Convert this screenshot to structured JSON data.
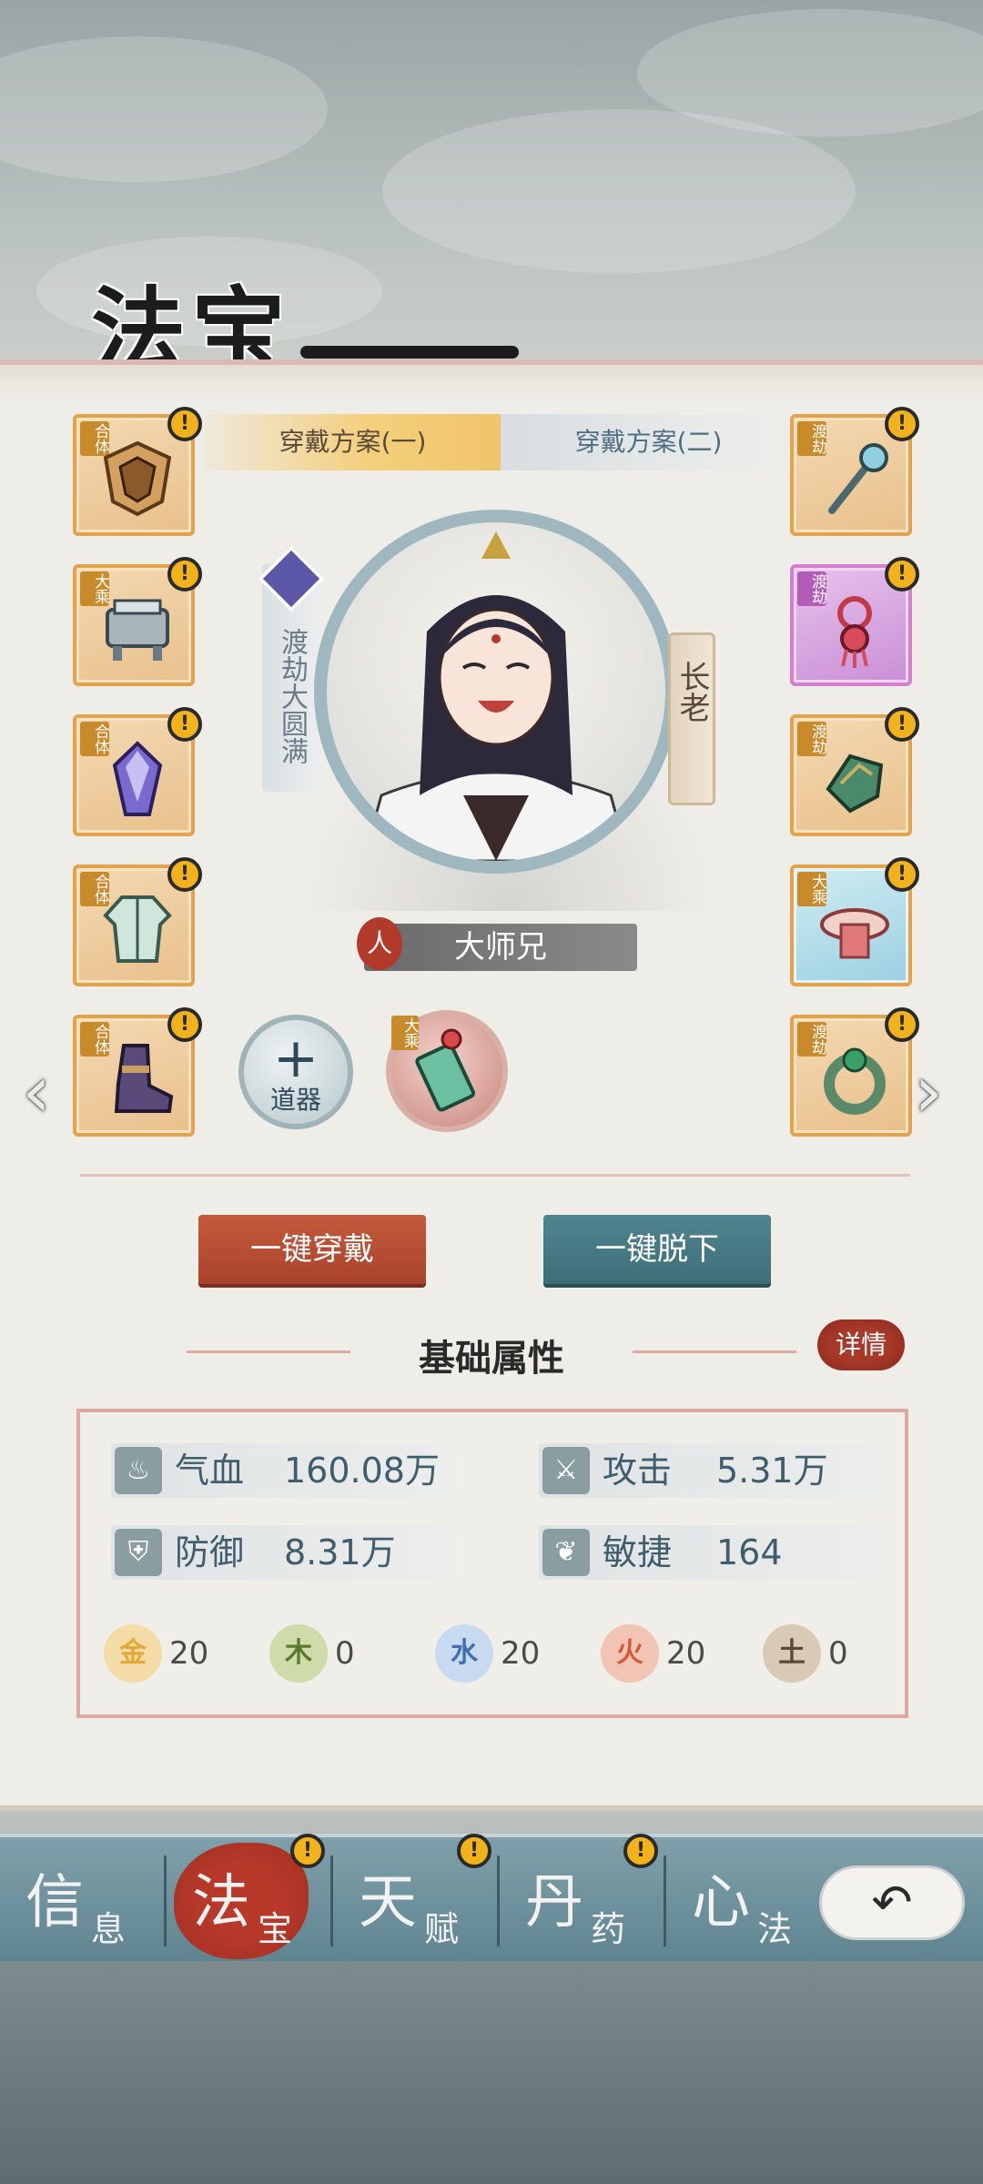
{
  "title": "法宝",
  "tabs": {
    "scheme1": "穿戴方案(一)",
    "scheme2": "穿戴方案(二)"
  },
  "character": {
    "realm": "渡劫大圆满",
    "rank": "长老",
    "name": "大师兄",
    "race_seal": "人"
  },
  "left_slots": [
    {
      "tag": "合体",
      "icon": "shield-icon"
    },
    {
      "tag": "大乘",
      "icon": "cauldron-icon"
    },
    {
      "tag": "合体",
      "icon": "crystal-icon"
    },
    {
      "tag": "合体",
      "icon": "robe-icon"
    },
    {
      "tag": "合体",
      "icon": "boots-icon"
    }
  ],
  "right_slots": [
    {
      "tag": "渡劫",
      "icon": "hairpin-icon"
    },
    {
      "tag": "渡劫",
      "icon": "tassel-charm-icon"
    },
    {
      "tag": "渡劫",
      "icon": "bracer-icon"
    },
    {
      "tag": "大乘",
      "icon": "belt-icon"
    },
    {
      "tag": "渡劫",
      "icon": "jade-ring-icon"
    }
  ],
  "tool_button": {
    "plus": "+",
    "label": "道器"
  },
  "talisman": {
    "tag": "大乘",
    "icon": "talisman-icon"
  },
  "alert_glyph": "!",
  "actions": {
    "wear_all": "一键穿戴",
    "unwear_all": "一键脱下"
  },
  "section": {
    "title": "基础属性",
    "detail": "详情"
  },
  "stats": [
    {
      "label": "气血",
      "value": "160.08万",
      "icon": "blood-icon"
    },
    {
      "label": "攻击",
      "value": "5.31万",
      "icon": "attack-icon"
    },
    {
      "label": "防御",
      "value": "8.31万",
      "icon": "defense-icon"
    },
    {
      "label": "敏捷",
      "value": "164",
      "icon": "agility-icon"
    }
  ],
  "elements": [
    {
      "glyph": "金",
      "value": "20",
      "color": "#e2a83a"
    },
    {
      "glyph": "木",
      "value": "0",
      "color": "#7a9a45"
    },
    {
      "glyph": "水",
      "value": "20",
      "color": "#3f6fb0"
    },
    {
      "glyph": "火",
      "value": "20",
      "color": "#d45a3a"
    },
    {
      "glyph": "土",
      "value": "0",
      "color": "#8a6a4a"
    }
  ],
  "nav": [
    {
      "big": "信",
      "small": "息"
    },
    {
      "big": "法",
      "small": "宝"
    },
    {
      "big": "天",
      "small": "赋"
    },
    {
      "big": "丹",
      "small": "药"
    },
    {
      "big": "心",
      "small": "法"
    }
  ],
  "back_glyph": "↶"
}
